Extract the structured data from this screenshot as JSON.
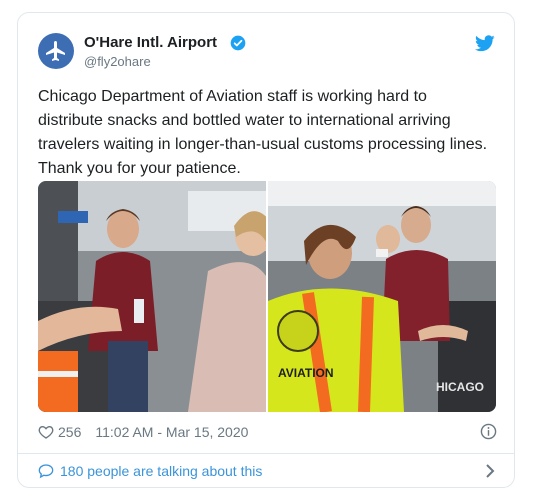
{
  "tweet": {
    "author": {
      "name": "O'Hare Intl. Airport",
      "handle": "@fly2ohare",
      "avatar_icon": "airplane-icon",
      "avatar_color": "#3d6eb4",
      "verified": true
    },
    "text": "Chicago Department of Aviation staff is working hard to\ndistribute snacks and bottled water to international arriving\ntravelers waiting in longer-than-usual customs processing lines.\nThank you for your patience.",
    "media": [
      {
        "kind": "photo",
        "subject": "airport staff handing water bottle to traveler in maroon hoodie"
      },
      {
        "kind": "photo",
        "subject": "staff member in yellow AVIATION safety vest handing item to travelers"
      }
    ],
    "vest_text": "AVIATION",
    "sign_text": "HICAGO",
    "likes": "256",
    "timestamp": "11:02 AM - Mar 15, 2020",
    "conversation_label": "180 people are talking about this"
  },
  "colors": {
    "brand_blue": "#1da1f2",
    "link_blue": "#3b94d9",
    "muted": "#697882",
    "text": "#1c2022",
    "border": "#e1e8ed"
  },
  "icons": {
    "verified": "verified-badge-icon",
    "brand": "twitter-bird-icon",
    "like": "heart-icon",
    "info": "info-icon",
    "conversation": "speech-bubble-icon",
    "chevron": "chevron-right-icon"
  }
}
